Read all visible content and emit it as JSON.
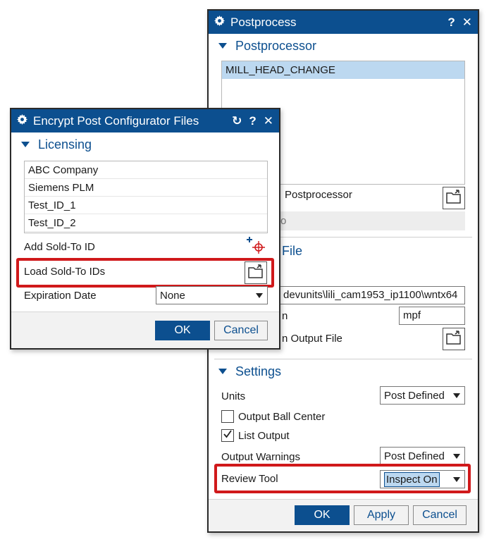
{
  "postprocess": {
    "title": "Postprocess",
    "help": "?",
    "close": "✕",
    "postprocessor": {
      "section_title": "Postprocessor",
      "items": [
        "MILL_HEAD_CHANGE"
      ],
      "browse_label": "Postprocessor",
      "partial_row": "o"
    },
    "output_file": {
      "section_title": "File",
      "path": "devunits\\lili_cam1953_ip1100\\wntx64",
      "extension_label": "n",
      "extension_value": "mpf",
      "browse_label": "n Output File"
    },
    "settings": {
      "section_title": "Settings",
      "units_label": "Units",
      "units_value": "Post Defined",
      "ball_center_label": "Output Ball Center",
      "ball_center_checked": false,
      "list_output_label": "List Output",
      "list_output_checked": true,
      "warnings_label": "Output Warnings",
      "warnings_value": "Post Defined",
      "review_label": "Review Tool",
      "review_value": "Inspect On"
    },
    "buttons": {
      "ok": "OK",
      "apply": "Apply",
      "cancel": "Cancel"
    }
  },
  "encrypt": {
    "title": "Encrypt Post Configurator Files",
    "reset": "↻",
    "help": "?",
    "close": "✕",
    "licensing": {
      "section_title": "Licensing",
      "ids": [
        "ABC Company",
        "Siemens PLM",
        "Test_ID_1",
        "Test_ID_2"
      ],
      "add_label": "Add Sold-To ID",
      "load_label": "Load Sold-To IDs",
      "expiration_label": "Expiration Date",
      "expiration_value": "None"
    },
    "buttons": {
      "ok": "OK",
      "cancel": "Cancel"
    }
  },
  "colors": {
    "title_bar": "#0c4f8f",
    "selection": "#bcd8f0",
    "highlight_box": "#d0191b"
  }
}
